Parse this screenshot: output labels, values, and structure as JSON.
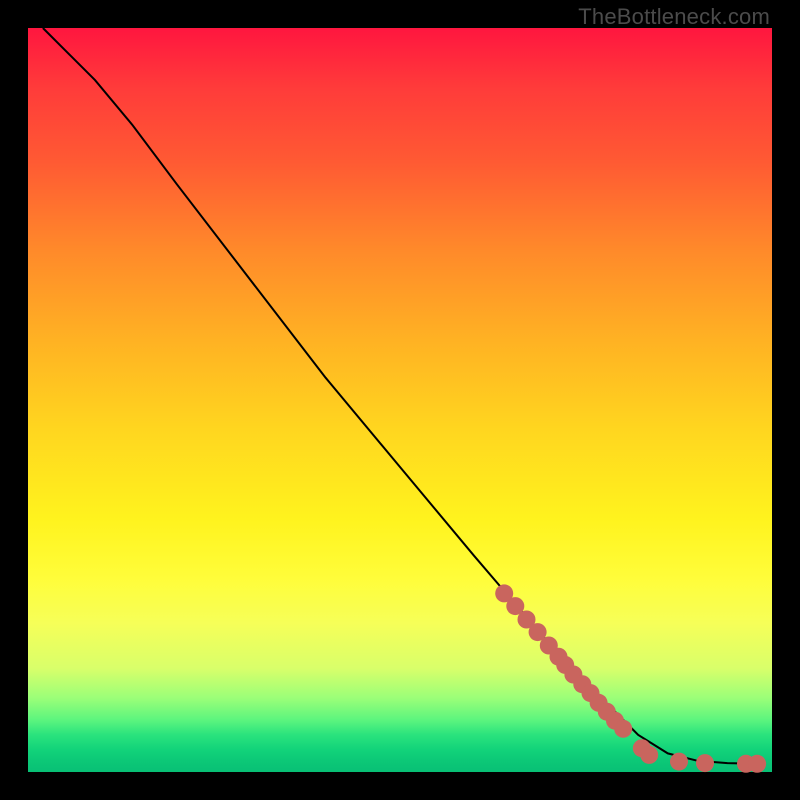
{
  "watermark": "TheBottleneck.com",
  "chart_data": {
    "type": "line",
    "title": "",
    "xlabel": "",
    "ylabel": "",
    "xlim": [
      0,
      100
    ],
    "ylim": [
      0,
      100
    ],
    "curve": [
      {
        "x": 2,
        "y": 100
      },
      {
        "x": 5,
        "y": 97
      },
      {
        "x": 9,
        "y": 93
      },
      {
        "x": 14,
        "y": 87
      },
      {
        "x": 20,
        "y": 79
      },
      {
        "x": 30,
        "y": 66
      },
      {
        "x": 40,
        "y": 53
      },
      {
        "x": 50,
        "y": 41
      },
      {
        "x": 60,
        "y": 29
      },
      {
        "x": 66,
        "y": 22
      },
      {
        "x": 72,
        "y": 15
      },
      {
        "x": 78,
        "y": 9
      },
      {
        "x": 82,
        "y": 5
      },
      {
        "x": 86,
        "y": 2.5
      },
      {
        "x": 90,
        "y": 1.5
      },
      {
        "x": 94,
        "y": 1.2
      },
      {
        "x": 98,
        "y": 1.1
      }
    ],
    "dot_clusters": [
      {
        "x": 64,
        "y": 24
      },
      {
        "x": 65.5,
        "y": 22.3
      },
      {
        "x": 67,
        "y": 20.5
      },
      {
        "x": 68.5,
        "y": 18.8
      },
      {
        "x": 70,
        "y": 17
      },
      {
        "x": 71.3,
        "y": 15.5
      },
      {
        "x": 72.2,
        "y": 14.4
      },
      {
        "x": 73.3,
        "y": 13.1
      },
      {
        "x": 74.5,
        "y": 11.8
      },
      {
        "x": 75.6,
        "y": 10.6
      },
      {
        "x": 76.7,
        "y": 9.3
      },
      {
        "x": 77.8,
        "y": 8.1
      },
      {
        "x": 78.9,
        "y": 6.9
      },
      {
        "x": 80,
        "y": 5.8
      },
      {
        "x": 82.5,
        "y": 3.2
      },
      {
        "x": 83.5,
        "y": 2.3
      },
      {
        "x": 87.5,
        "y": 1.4
      },
      {
        "x": 91,
        "y": 1.2
      },
      {
        "x": 96.5,
        "y": 1.1
      },
      {
        "x": 98,
        "y": 1.1
      }
    ],
    "colors": {
      "curve": "#000000",
      "dots": "#c9655e"
    }
  }
}
